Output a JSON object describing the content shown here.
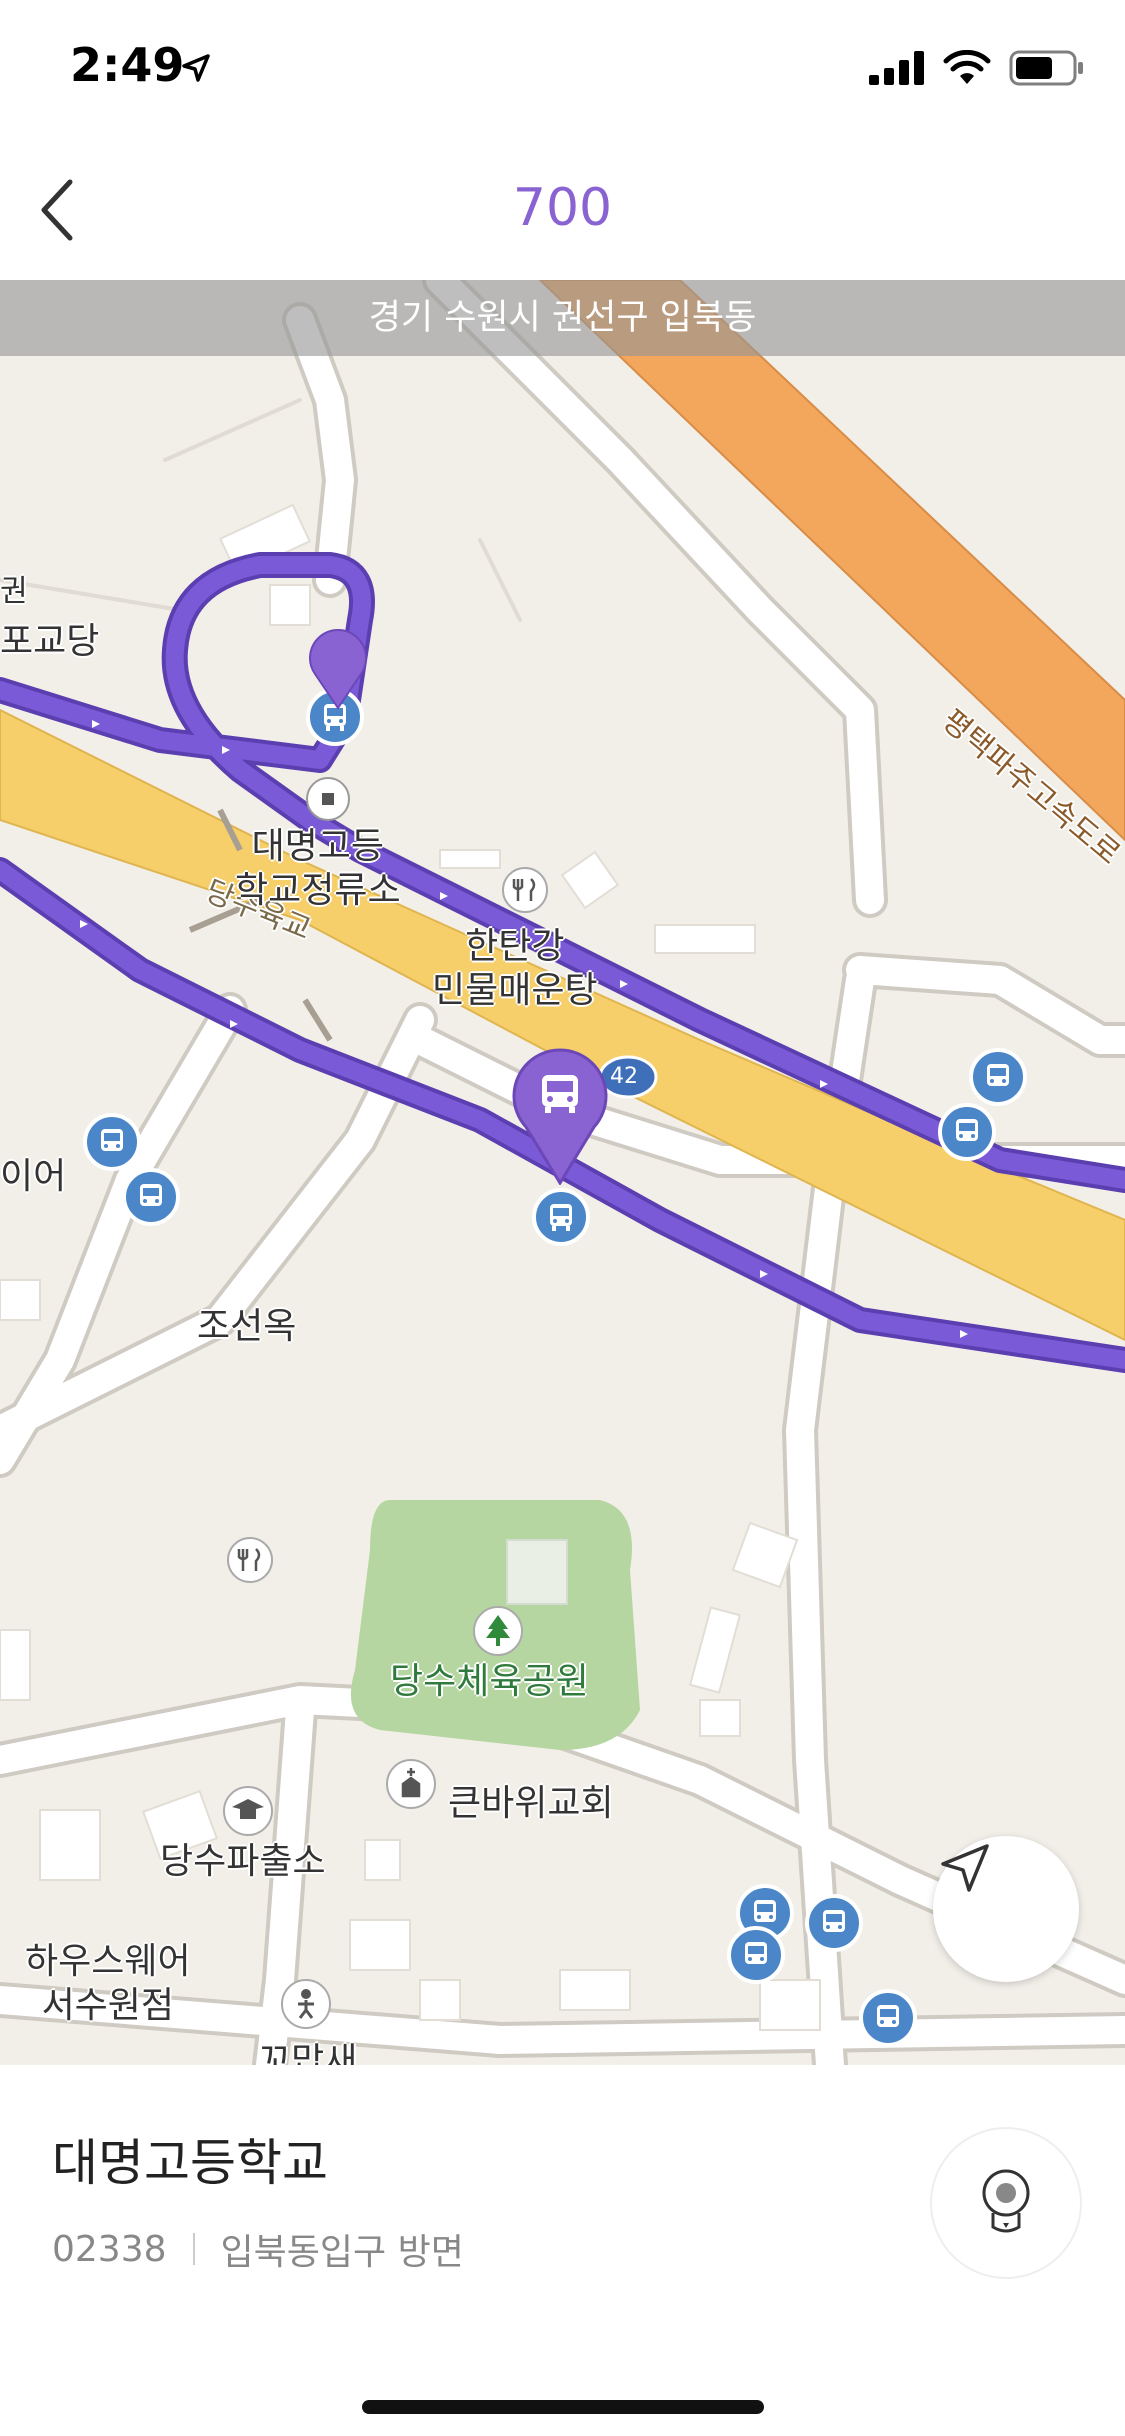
{
  "status_bar": {
    "time": "2:49",
    "location_icon": "location-arrow-icon",
    "signal_icon": "cellular-signal-icon",
    "wifi_icon": "wifi-icon",
    "battery_icon": "battery-icon"
  },
  "header": {
    "back_icon": "chevron-left-icon",
    "route_number": "700",
    "accent_color": "#8a63d2"
  },
  "map": {
    "address": "경기 수원시 권선구 입북동",
    "expressway_label": "평택파주고속도로",
    "bridge_label": "당수육교",
    "road_number": "42",
    "labels": {
      "left_edge_1": "권",
      "left_edge_2": "포교당",
      "stop_label": "대명고등\n학교정류소",
      "restaurant_1": "한탄강\n민물매운탕",
      "restaurant_2": "조선옥",
      "park": "당수체육공원",
      "church": "큰바위교회",
      "police": "당수파출소",
      "store": "하우스웨어\n서수원점",
      "left_edge_3": "이어",
      "bottom_cut": "꼬맙새"
    },
    "colors": {
      "route": "#6e4fc0",
      "expressway": "#f2a75c",
      "highway": "#f6cf6a",
      "park": "#b5d6a0",
      "bus_stop": "#4a86c8"
    }
  },
  "stop_panel": {
    "name": "대명고등학교",
    "stop_id": "02338",
    "direction": "입북동입구 방면",
    "cctv_icon": "cctv-camera-icon"
  },
  "locate_icon": "navigation-arrow-icon"
}
